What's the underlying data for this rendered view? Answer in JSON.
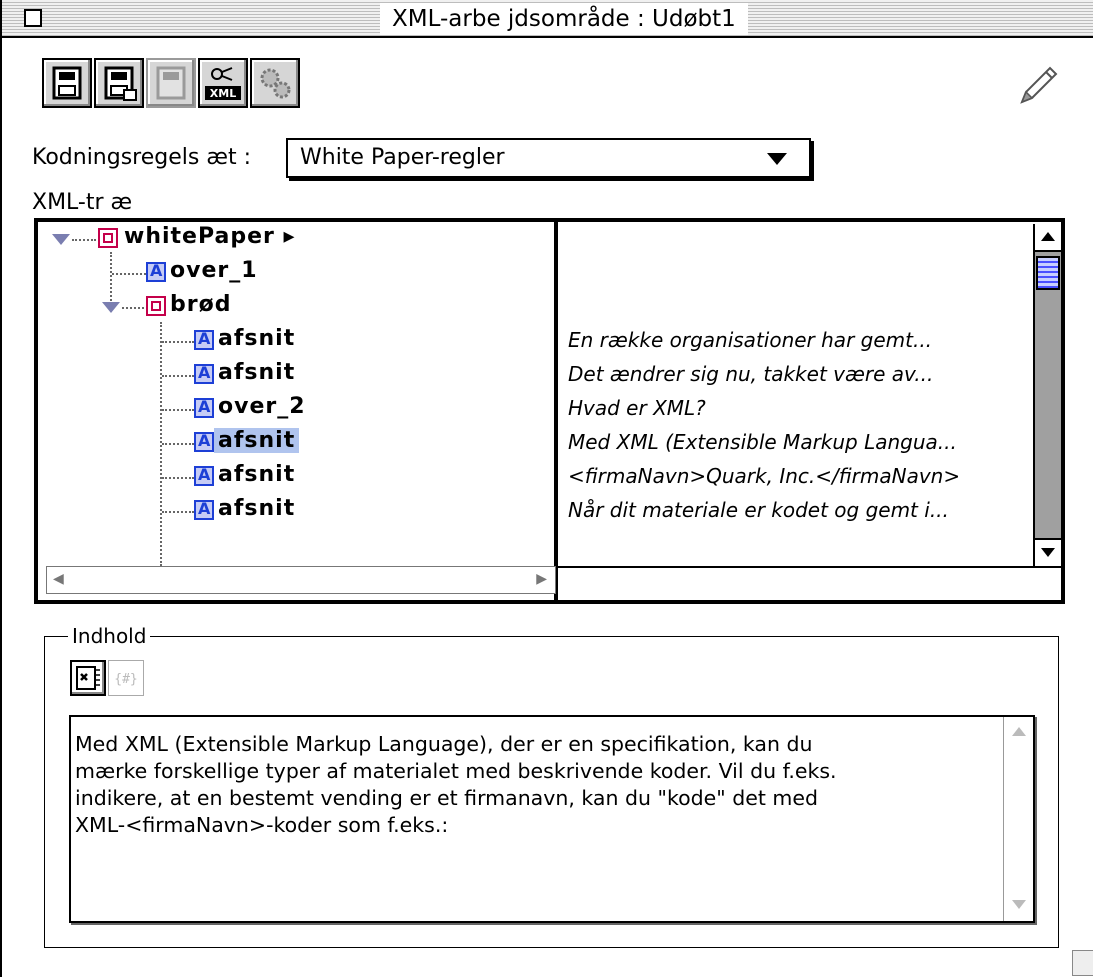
{
  "window": {
    "title": "XML-arbe jdsområde : Udøbt1"
  },
  "toolbar": {
    "buttons": [
      {
        "name": "save-icon"
      },
      {
        "name": "save-as-icon"
      },
      {
        "name": "revert-icon",
        "disabled": true
      },
      {
        "name": "xml-validate-icon",
        "label": "XML"
      },
      {
        "name": "gears-icon"
      }
    ],
    "pencil": "pencil-icon"
  },
  "rules": {
    "label": "Kodningsregels æt :",
    "selected": "White Paper-regler"
  },
  "tree": {
    "label": "XML-tr æ",
    "nodes": [
      {
        "label": "whitePaper ▸",
        "content": ""
      },
      {
        "label": "over_1",
        "content": ""
      },
      {
        "label": "brød",
        "content": ""
      },
      {
        "label": "afsnit",
        "content": "En række organisationer har gemt..."
      },
      {
        "label": "afsnit",
        "content": "Det ændrer sig nu, takket være av..."
      },
      {
        "label": "over_2",
        "content": "Hvad er XML?"
      },
      {
        "label": "afsnit",
        "content": "Med XML (Extensible Markup Langua..."
      },
      {
        "label": "afsnit",
        "content": "<firmaNavn>Quark, Inc.</firmaNavn>"
      },
      {
        "label": "afsnit",
        "content": "Når dit materiale er kodet og gemt i..."
      }
    ]
  },
  "content": {
    "label": "Indhold",
    "text": "Med XML (Extensible Markup Language), der er en specifikation, kan du\nmærke forskellige typer af materialet med beskrivende koder. Vil du f.eks.\nindikere, at en bestemt vending er et firmanavn, kan du \"kode\" det med\nXML-<firmaNavn>-koder som f.eks.:"
  }
}
